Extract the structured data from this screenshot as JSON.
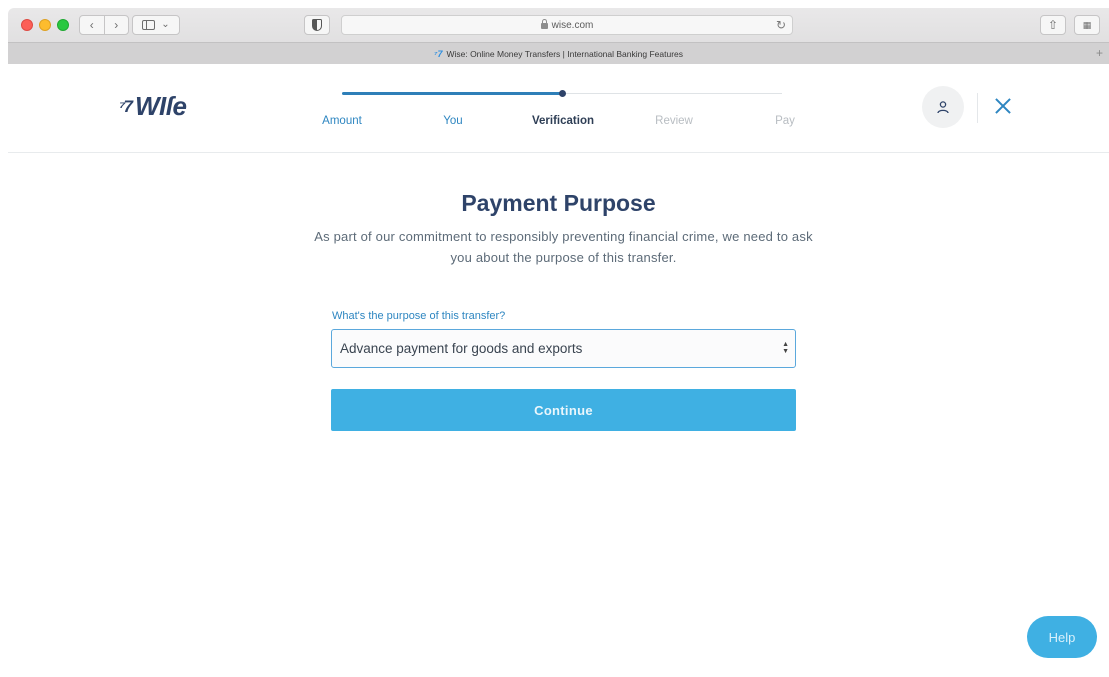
{
  "browser": {
    "url": "wise.com",
    "tab_title": "Wise: Online Money Transfers | International Banking Features",
    "tab_favicon": "wise-flag-icon",
    "nav_back": "‹",
    "nav_forward": "›",
    "reload_glyph": "↻",
    "share_glyph": "⇧",
    "tabs_glyph": "▦",
    "new_tab_glyph": "+",
    "sidebar_chevron": "⌄"
  },
  "header": {
    "logo_flag": "⁷7",
    "logo_text": "WIſe",
    "steps": [
      {
        "label": "Amount",
        "state": "done"
      },
      {
        "label": "You",
        "state": "done"
      },
      {
        "label": "Verification",
        "state": "current"
      },
      {
        "label": "Review",
        "state": "todo"
      },
      {
        "label": "Pay",
        "state": "todo"
      }
    ],
    "progress_fraction": 0.5
  },
  "main": {
    "title": "Payment Purpose",
    "subtitle": "As part of our commitment to responsibly preventing financial crime, we need to ask you about the purpose of this transfer.",
    "purpose_field": {
      "label": "What's the purpose of this transfer?",
      "selected": "Advance payment for goods and exports"
    },
    "continue_label": "Continue"
  },
  "help_label": "Help",
  "colors": {
    "brand_navy": "#2e4369",
    "accent_blue": "#3fb0e3",
    "link_blue": "#2e86c1"
  }
}
